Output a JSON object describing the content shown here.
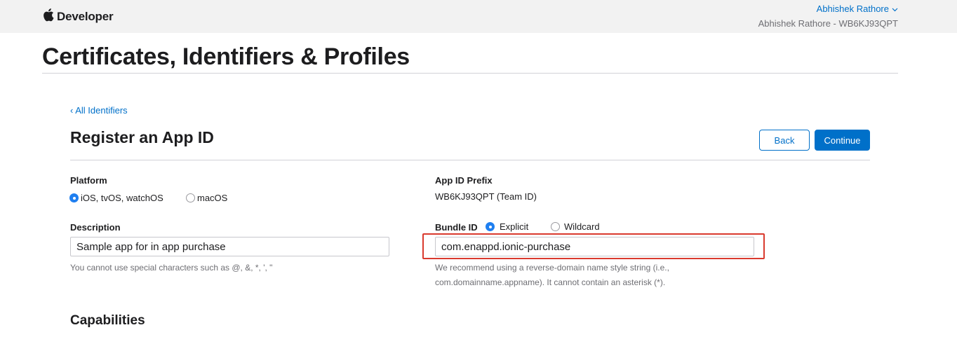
{
  "header": {
    "brand": "Developer",
    "account_name": "Abhishek Rathore",
    "account_team": "Abhishek Rathore - WB6KJ93QPT"
  },
  "page_title": "Certificates, Identifiers & Profiles",
  "nav": {
    "back_link": "‹ All Identifiers"
  },
  "section_title": "Register an App ID",
  "buttons": {
    "back": "Back",
    "continue": "Continue"
  },
  "platform": {
    "label": "Platform",
    "options": [
      {
        "label": "iOS, tvOS, watchOS",
        "selected": true
      },
      {
        "label": "macOS",
        "selected": false
      }
    ]
  },
  "app_id_prefix": {
    "label": "App ID Prefix",
    "value": "WB6KJ93QPT (Team ID)"
  },
  "description": {
    "label": "Description",
    "value": "Sample app for in app purchase",
    "help": "You cannot use special characters such as @, &, *, ', \""
  },
  "bundle_id": {
    "label": "Bundle ID",
    "options": [
      {
        "label": "Explicit",
        "selected": true
      },
      {
        "label": "Wildcard",
        "selected": false
      }
    ],
    "value": "com.enappd.ionic-purchase",
    "help_line1": "We recommend using a reverse-domain name style string (i.e.,",
    "help_line2": "com.domainname.appname). It cannot contain an asterisk (*)."
  },
  "capabilities_title": "Capabilities",
  "colors": {
    "accent": "#0070c9",
    "highlight": "#d93a2e",
    "topbar": "#f2f2f2"
  },
  "icons": [
    "apple-logo-icon",
    "chevron-down-icon"
  ]
}
